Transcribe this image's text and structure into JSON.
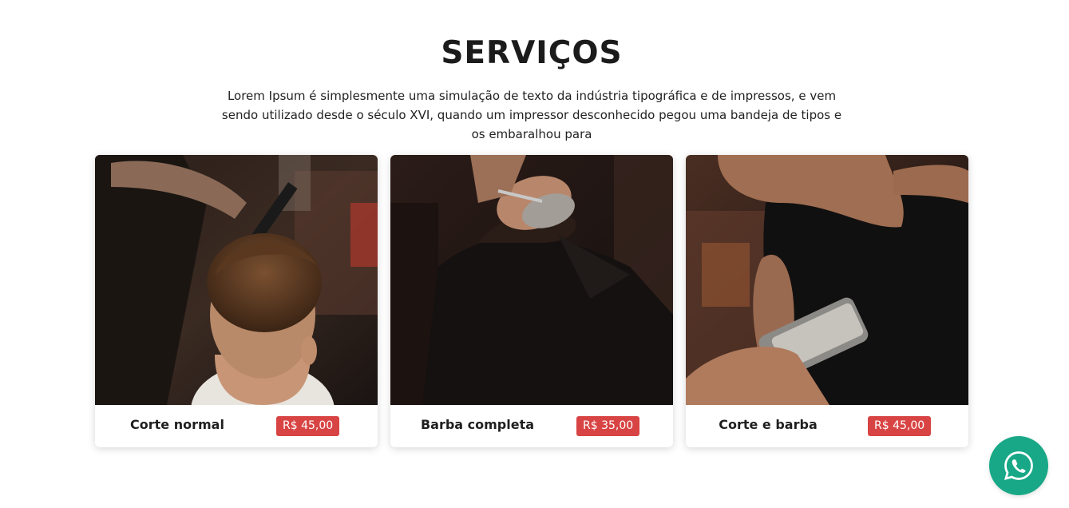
{
  "section": {
    "title": "SERVIÇOS",
    "description": "Lorem Ipsum é simplesmente uma simulação de texto da indústria tipográfica e de impressos, e vem sendo utilizado desde o século XVI, quando um impressor desconhecido pegou uma bandeja de tipos e os embaralhou para"
  },
  "services": [
    {
      "name": "Corte normal",
      "price": "R$ 45,00",
      "image_icon": "haircut-photo"
    },
    {
      "name": "Barba completa",
      "price": "R$ 35,00",
      "image_icon": "beard-trim-photo"
    },
    {
      "name": "Corte e barba",
      "price": "R$ 45,00",
      "image_icon": "clipper-haircut-photo"
    }
  ],
  "whatsapp_button": {
    "icon": "whatsapp-icon",
    "color": "#18a887"
  },
  "colors": {
    "price_badge": "#d84444",
    "text": "#1c1b1b"
  }
}
